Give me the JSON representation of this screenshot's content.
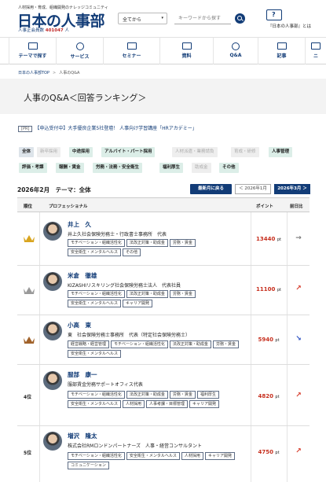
{
  "header": {
    "tagline": "人材採用・育成、組織開発のナレッジコミュニティ",
    "logo": "日本の人事部",
    "members_label": "人事正会員数",
    "members_count": "401047",
    "members_unit": "人",
    "scope_select": "全てから",
    "search_placeholder": "キーワードから探す",
    "help_label": "『日本の人事部』とは"
  },
  "nav": [
    {
      "label": "テーマで探す",
      "icon": "theme-icon"
    },
    {
      "label": "サービス",
      "icon": "service-icon"
    },
    {
      "label": "セミナー",
      "icon": "seminar-icon"
    },
    {
      "label": "資料",
      "icon": "document-icon"
    },
    {
      "label": "Q&A",
      "icon": "qa-icon"
    },
    {
      "label": "記事",
      "icon": "article-icon"
    },
    {
      "label": "ニ",
      "icon": "news-icon"
    }
  ],
  "breadcrumb": {
    "home": "日本の人事部TOP",
    "current": "人事のQ&A"
  },
  "page_title": "人事のQ&A＜回答ランキング＞",
  "pr": {
    "tag": "[PR]",
    "text": "【申込受付中】大手優良企業5社登壇！ 人事向け学習講座「HRアカデミー」"
  },
  "categories": [
    {
      "label": "全体",
      "state": "on"
    },
    {
      "label": "新卒採用",
      "state": "grey"
    },
    {
      "label": "中途採用",
      "state": "norm"
    },
    {
      "label": "アルバイト・パート採用",
      "state": "norm"
    },
    {
      "label": "人材派遣・業務請負",
      "state": "grey"
    },
    {
      "label": "育成・研修",
      "state": "grey"
    },
    {
      "label": "人事管理",
      "state": "norm"
    },
    {
      "label": "評価・考課",
      "state": "norm"
    },
    {
      "label": "報酬・賃金",
      "state": "norm"
    },
    {
      "label": "労務・法務・安全衛生",
      "state": "norm"
    },
    {
      "label": "福利厚生",
      "state": "norm"
    },
    {
      "label": "助成金",
      "state": "grey"
    },
    {
      "label": "その他",
      "state": "norm"
    }
  ],
  "month_bar": {
    "label": "2026年2月　テーマ：全体",
    "latest": "最新月に戻る",
    "prev": "＜ 2026年1月",
    "next": "2026年3月 ＞"
  },
  "table_head": {
    "rank": "順位",
    "pro": "プロフェッショナル",
    "points": "ポイント",
    "prev": "前日比"
  },
  "rows": [
    {
      "rank": "",
      "medal": "gold",
      "name": "井上　久",
      "org": "井上久社会保険労務士・行政書士事務所　代表",
      "tags": [
        "モチベーション・組織活性化",
        "法改正対策・助成金",
        "労務・賃金",
        "安全衛生・メンタルヘルス",
        "その他"
      ],
      "points": "13440",
      "unit": "pt",
      "trend": "→",
      "trend_color": "#777"
    },
    {
      "rank": "",
      "medal": "silver",
      "name": "米倉　徹雄",
      "org": "KIZASHIリスキリング社会保険労務士法人　代表社員",
      "tags": [
        "モチベーション・組織活性化",
        "法改正対策・助成金",
        "労務・賃金",
        "安全衛生・メンタルヘルス",
        "キャリア開発"
      ],
      "points": "11100",
      "unit": "pt",
      "trend": "↗",
      "trend_color": "#d63a2a"
    },
    {
      "rank": "",
      "medal": "bronze",
      "name": "小高　東",
      "org": "東　社会保険労務士事務所　代表（特定社会保険労務士）",
      "tags": [
        "経営戦略・経営管理",
        "モチベーション・組織活性化",
        "法改正対策・助成金",
        "労務・賃金",
        "安全衛生・メンタルヘルス"
      ],
      "points": "5940",
      "unit": "pt",
      "trend": "↘",
      "trend_color": "#2b4fc2"
    },
    {
      "rank": "4位",
      "medal": "",
      "name": "服部　康一",
      "org": "服部賃金労務サポートオフィス代表",
      "tags": [
        "モチベーション・組織活性化",
        "法改正対策・助成金",
        "労務・賃金",
        "福利厚生",
        "安全衛生・メンタルヘルス",
        "人材採用",
        "人事考課・目標管理",
        "キャリア開発"
      ],
      "points": "4820",
      "unit": "pt",
      "trend": "↗",
      "trend_color": "#d63a2a"
    },
    {
      "rank": "5位",
      "medal": "",
      "name": "増沢　隆太",
      "org": "株式会社RMロンドンパートナーズ　人事・経営コンサルタント",
      "tags": [
        "モチベーション・組織活性化",
        "安全衛生・メンタルヘルス",
        "人材採用",
        "キャリア開発",
        "コミュニケーション"
      ],
      "points": "4750",
      "unit": "pt",
      "trend": "↗",
      "trend_color": "#d63a2a"
    }
  ],
  "colors": {
    "brand": "#123c77",
    "points": "#c7301f",
    "up": "#d63a2a",
    "down": "#2b4fc2"
  }
}
